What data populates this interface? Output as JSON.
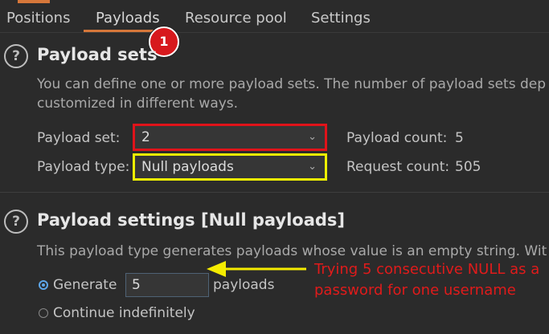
{
  "tabs": [
    {
      "label": "Positions"
    },
    {
      "label": "Payloads"
    },
    {
      "label": "Resource pool"
    },
    {
      "label": "Settings"
    }
  ],
  "active_tab": "Payloads",
  "badge_number": "1",
  "payload_sets": {
    "title": "Payload sets",
    "description_line1": "You can define one or more payload sets. The number of payload sets dep",
    "description_line2": "customized in different ways.",
    "set_label": "Payload set:",
    "set_value": "2",
    "type_label": "Payload type:",
    "type_value": "Null payloads",
    "payload_count_label": "Payload count:",
    "payload_count": "5",
    "request_count_label": "Request count:",
    "request_count": "505"
  },
  "payload_settings": {
    "title": "Payload settings [Null payloads]",
    "description": "This payload type generates payloads whose value is an empty string. Wit",
    "generate_label": "Generate",
    "generate_value": "5",
    "payloads_suffix": "payloads",
    "continue_label": "Continue indefinitely",
    "selected_option": "Generate"
  },
  "annotation": {
    "line1": "Trying 5 consecutive NULL as a",
    "line2": "password for one username"
  },
  "colors": {
    "accent": "#d6773a",
    "highlight_red": "#e0131a",
    "highlight_yellow": "#eef000",
    "annotation_red": "#e01b1b",
    "arrow_yellow": "#f5ec00"
  },
  "icons": [
    "help-icon",
    "chevron-down-icon",
    "radio-icon",
    "arrow-left-icon"
  ]
}
